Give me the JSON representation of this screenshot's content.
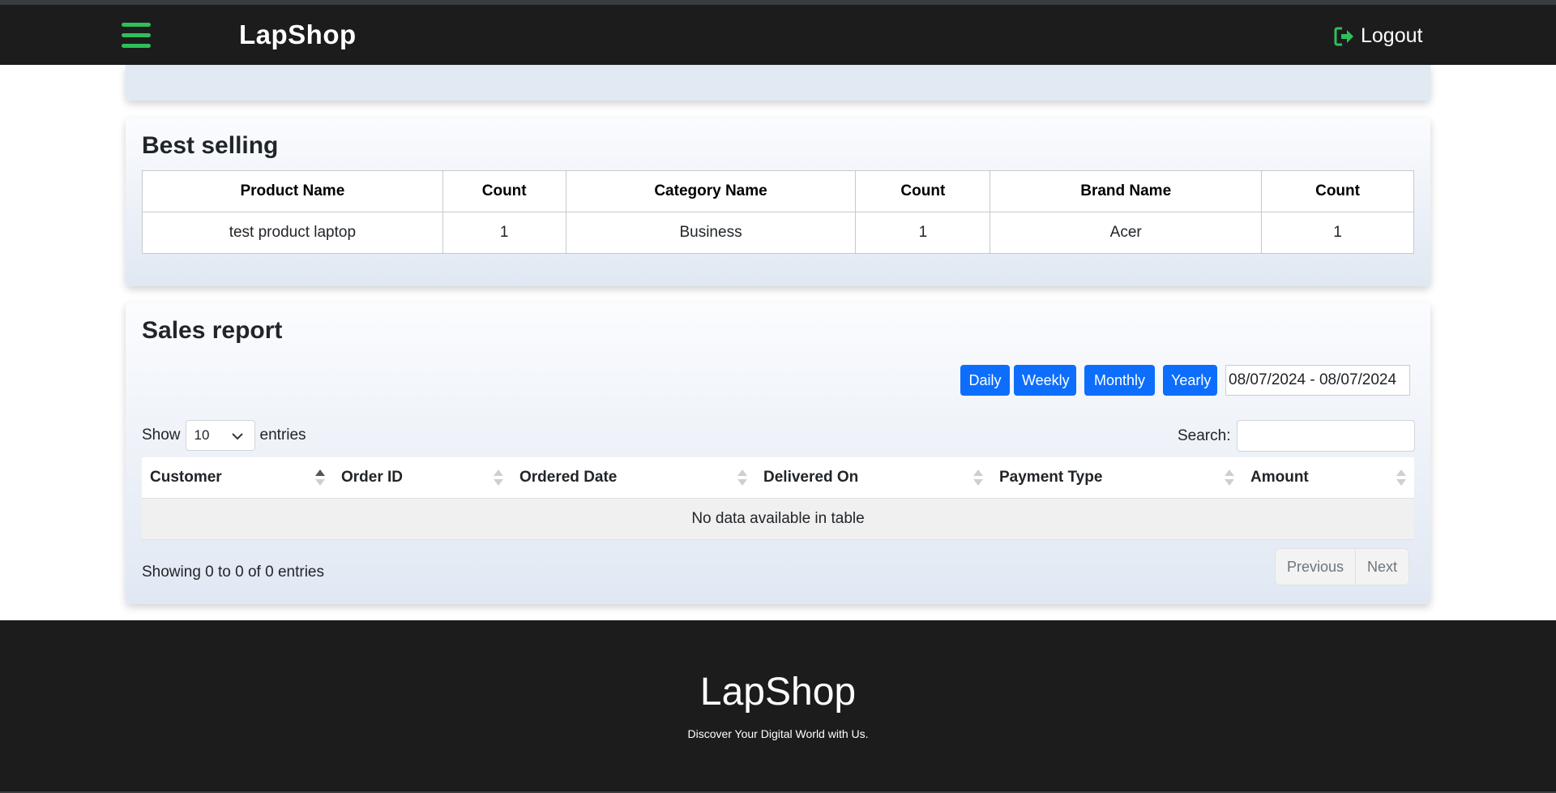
{
  "nav": {
    "brand": "LapShop",
    "logout_label": "Logout",
    "accent_color": "#2fbf5b"
  },
  "best_selling": {
    "title": "Best selling",
    "headers": [
      "Product Name",
      "Count",
      "Category Name",
      "Count",
      "Brand Name",
      "Count"
    ],
    "row": [
      "test product laptop",
      "1",
      "Business",
      "1",
      "Acer",
      "1"
    ]
  },
  "sales_report": {
    "title": "Sales report",
    "filters": [
      "Daily",
      "Weekly",
      "Monthly",
      "Yearly"
    ],
    "date_range": "08/07/2024 - 08/07/2024",
    "show_label": "Show",
    "entries_value": "10",
    "entries_label": "entries",
    "search_label": "Search:",
    "columns": [
      "Customer",
      "Order ID",
      "Ordered Date",
      "Delivered On",
      "Payment Type",
      "Amount"
    ],
    "empty_message": "No data available in table",
    "info": "Showing 0 to 0 of 0 entries",
    "prev_label": "Previous",
    "next_label": "Next",
    "button_color": "#0d6efd"
  },
  "footer": {
    "brand": "LapShop",
    "tagline": "Discover Your Digital World with Us."
  }
}
